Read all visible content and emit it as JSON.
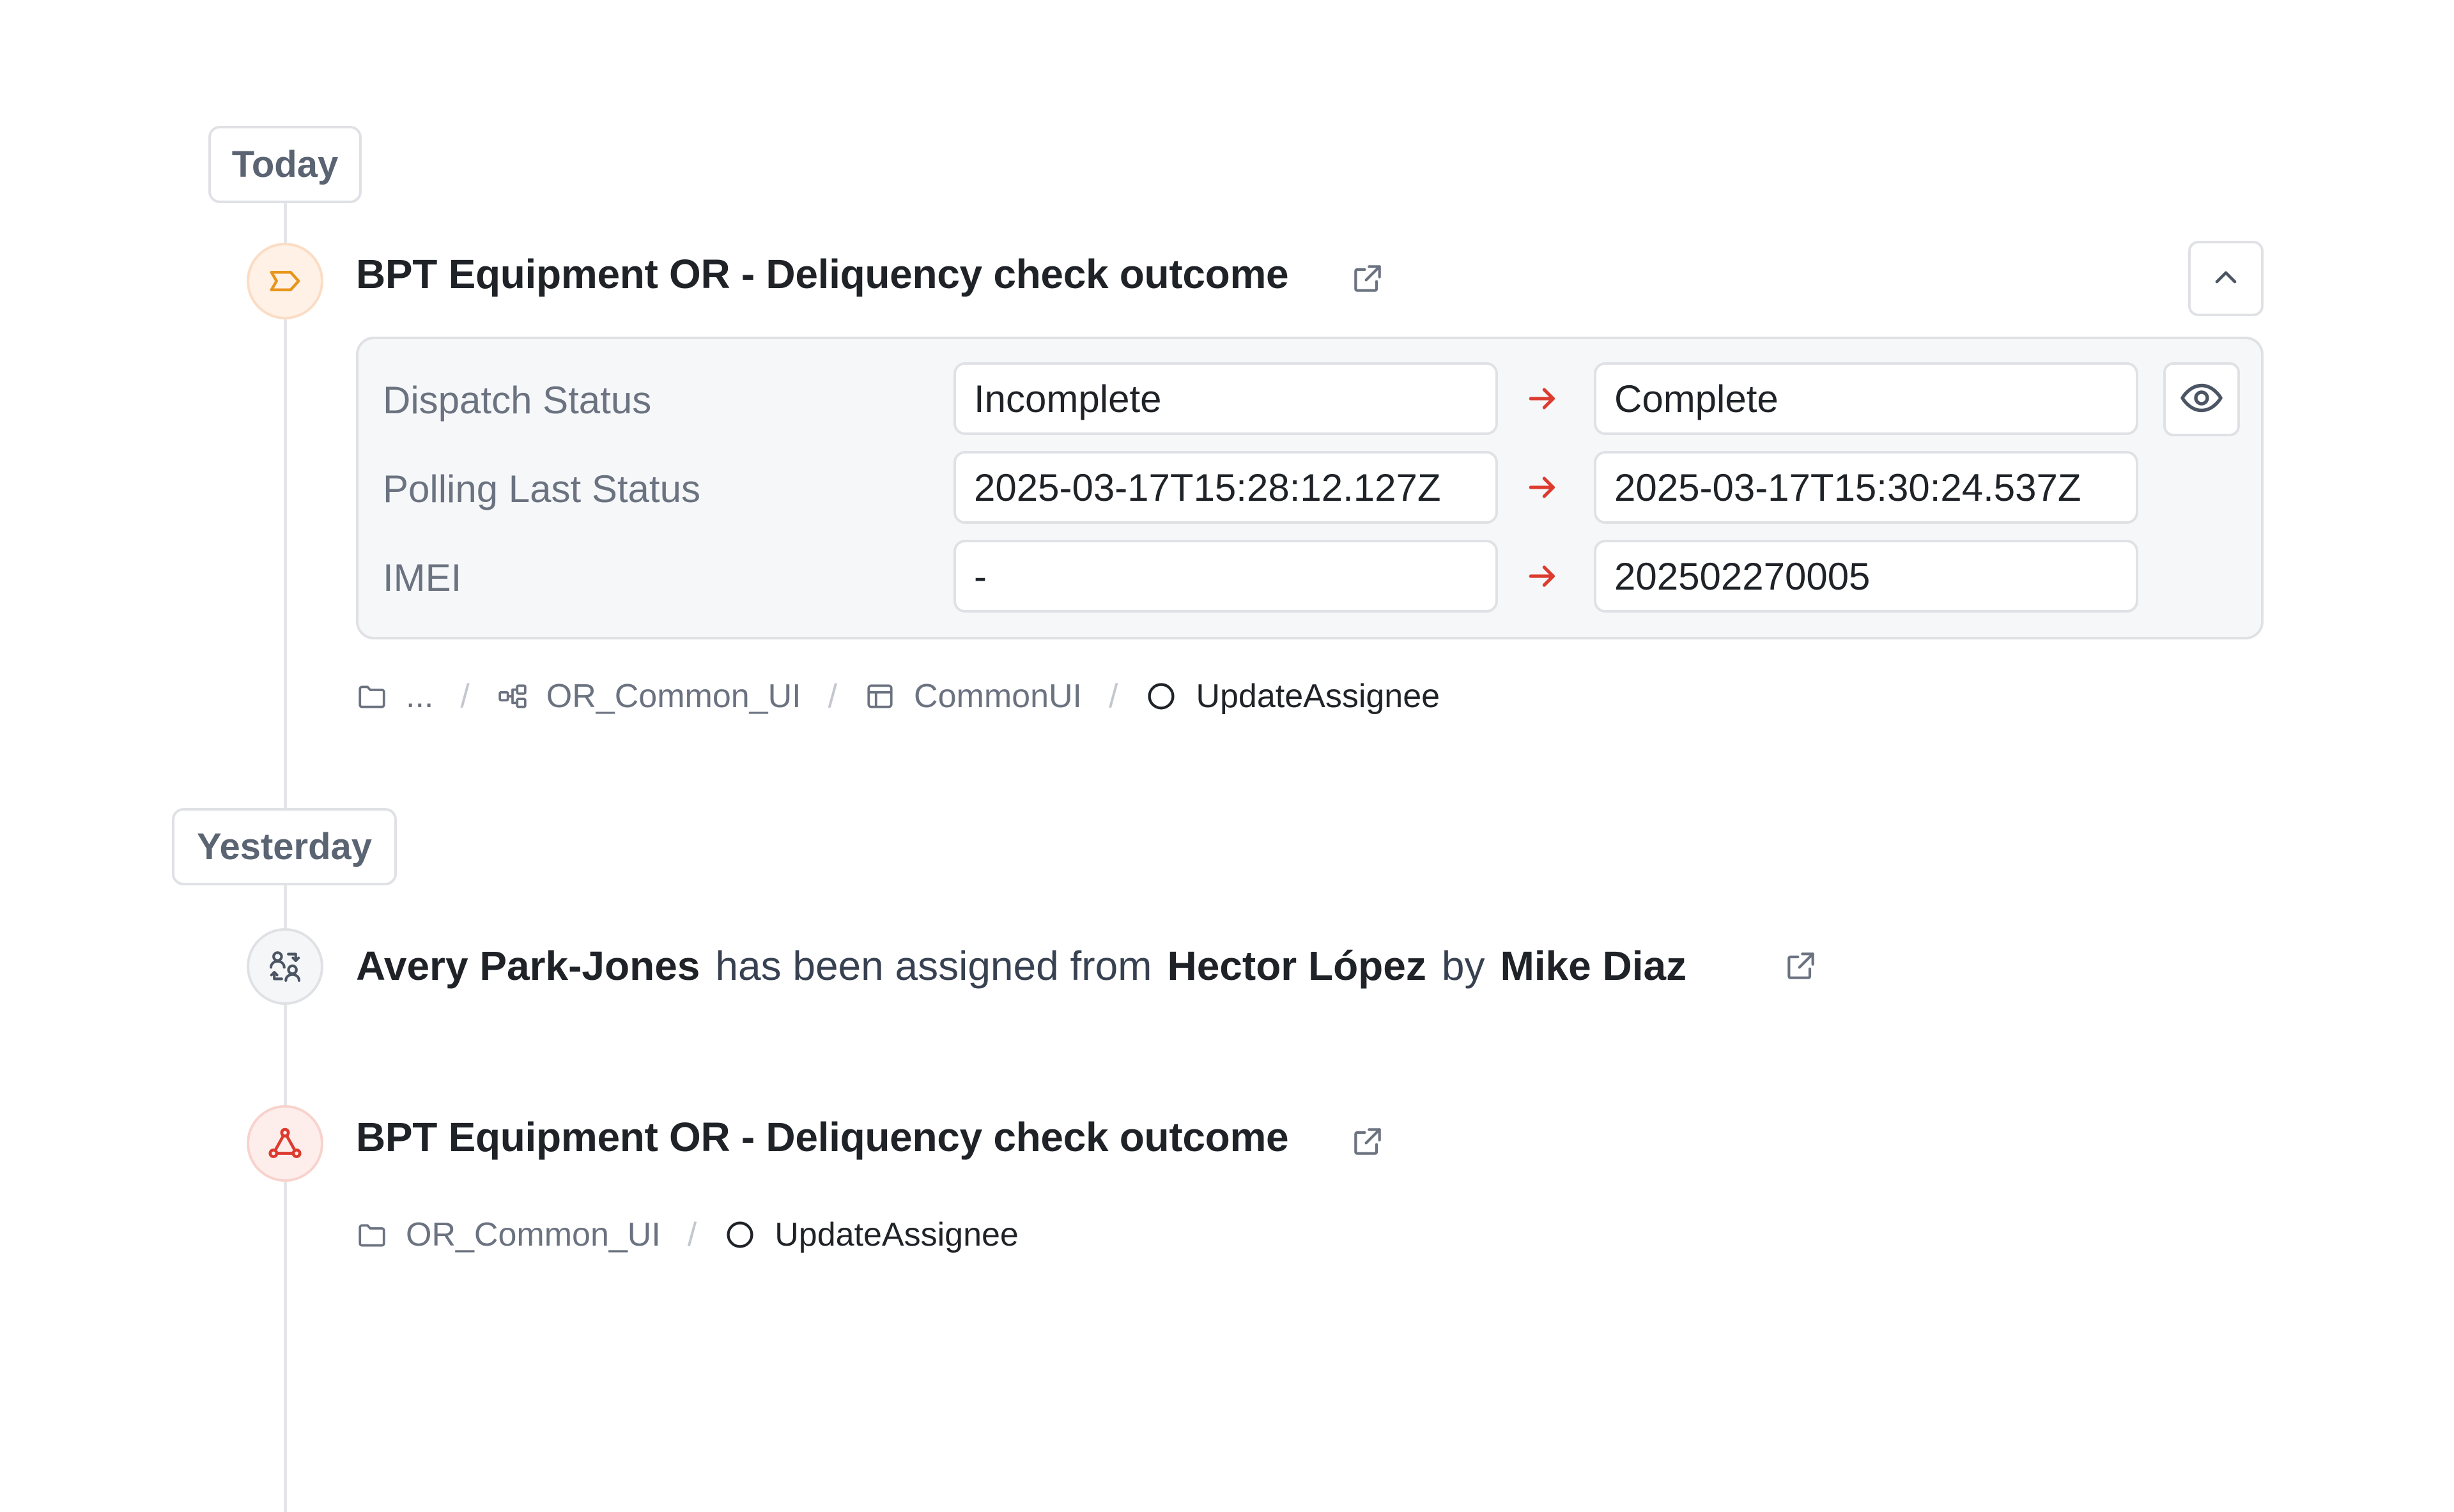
{
  "timeline": {
    "groups": [
      {
        "label": "Today",
        "events": [
          {
            "type": "rule-outcome",
            "icon": "tag-icon",
            "title": "BPT Equipment OR - Deliquency check outcome",
            "changes": [
              {
                "field": "Dispatch Status",
                "from": "Incomplete",
                "to": "Complete"
              },
              {
                "field": "Polling Last Status",
                "from": "2025-03-17T15:28:12.127Z",
                "to": "2025-03-17T15:30:24.537Z"
              },
              {
                "field": "IMEI",
                "from": "-",
                "to": "202502270005"
              }
            ],
            "breadcrumbs": [
              {
                "icon": "folder-icon",
                "label": "..."
              },
              {
                "icon": "workflow-icon",
                "label": "OR_Common_UI"
              },
              {
                "icon": "layout-icon",
                "label": "CommonUI"
              },
              {
                "icon": "circle-icon",
                "label": "UpdateAssignee"
              }
            ]
          }
        ]
      },
      {
        "label": "Yesterday",
        "events": [
          {
            "type": "assignment",
            "icon": "user-swap-icon",
            "assignee": "Avery Park-Jones",
            "text_assigned_from": "has been assigned from",
            "previous_assignee": "Hector López",
            "text_by": "by",
            "actor": "Mike Diaz"
          },
          {
            "type": "webhook",
            "icon": "webhook-icon",
            "title": "BPT Equipment OR - Deliquency check outcome",
            "breadcrumbs": [
              {
                "icon": "folder-icon",
                "label": "OR_Common_UI"
              },
              {
                "icon": "circle-icon",
                "label": "UpdateAssignee"
              }
            ]
          }
        ]
      }
    ]
  },
  "separator": "/",
  "colors": {
    "accent_orange": "#e8951c",
    "accent_red": "#dc3b2f",
    "arrow_red": "#dc3b2f",
    "text_primary": "#1f2328",
    "text_muted": "#6b7280",
    "border": "#dfe1e5",
    "panel_bg": "#f6f7f9"
  }
}
